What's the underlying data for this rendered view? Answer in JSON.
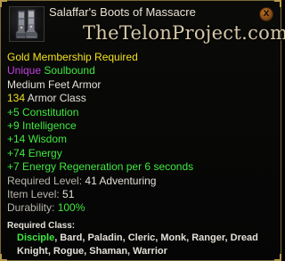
{
  "tooltip": {
    "item_name": "Salaffar's Boots of Massacre",
    "watermark": "TheTelonProject.com",
    "close_icon": "close-icon",
    "close_label": "X",
    "membership": "Gold Membership Required",
    "tag_unique": "Unique",
    "tag_soulbound": "Soulbound",
    "slot": "Medium Feet Armor",
    "armor_value": "134",
    "armor_label": "Armor Class",
    "stats": [
      "+5 Constitution",
      "+9 Intelligence",
      "+14 Wisdom",
      "+74 Energy",
      "+7 Energy Regeneration per 6 seconds"
    ],
    "required_level_label": "Required Level:",
    "required_level_value": "41 Adventuring",
    "item_level_label": "Item Level:",
    "item_level_value": "51",
    "durability_label": "Durability:",
    "durability_value": "100%",
    "required_class_label": "Required Class:",
    "classes_line1_active": "Disciple",
    "classes_line1_rest": ", Bard, Paladin, Cleric, Monk, Ranger, Dread",
    "classes_line2": "Knight, Rogue, Shaman, Warrior"
  },
  "colors": {
    "gold": "#f0e020",
    "purple": "#c040e0",
    "green": "#40e840",
    "white": "#e4e0d8",
    "border": "#7a6a3a"
  },
  "icons": {
    "item": "boots-icon"
  }
}
